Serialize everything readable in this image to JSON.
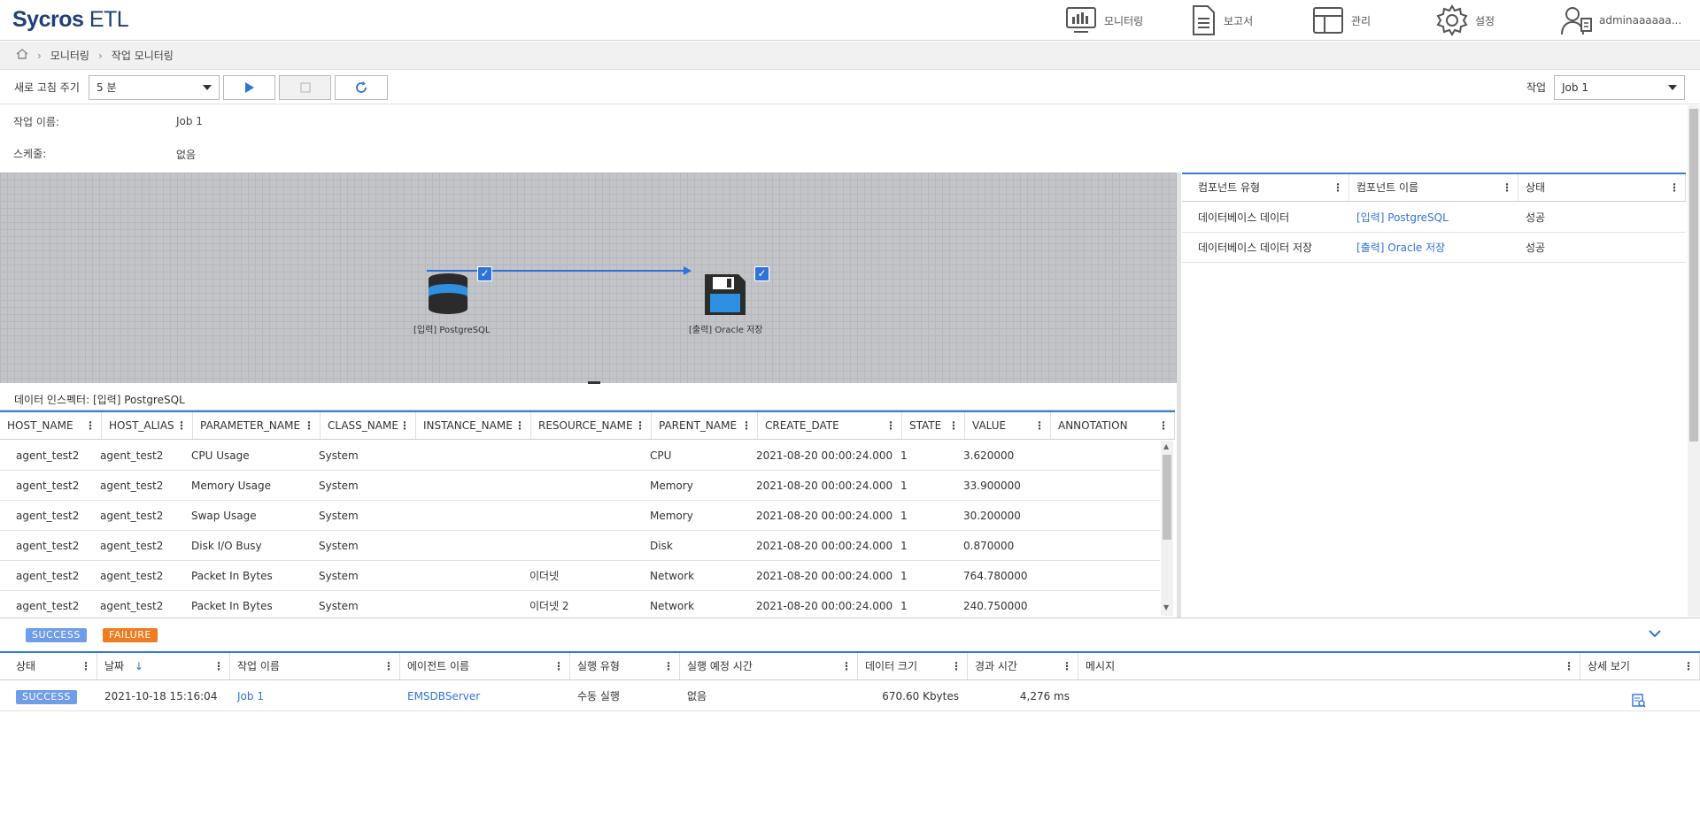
{
  "header": {
    "logo_main": "Sycros",
    "logo_sub": "ETL",
    "nav": [
      {
        "label": "모니터링",
        "icon": "monitor-icon"
      },
      {
        "label": "보고서",
        "icon": "report-icon"
      },
      {
        "label": "관리",
        "icon": "admin-icon"
      },
      {
        "label": "설정",
        "icon": "gear-icon"
      },
      {
        "label": "adminaaaaaa...",
        "icon": "user-icon"
      }
    ]
  },
  "breadcrumb": {
    "items": [
      "모니터링",
      "작업 모니터링"
    ]
  },
  "toolbar": {
    "refresh_label": "새로 고침 주기",
    "refresh_value": "5 분",
    "job_label": "작업",
    "job_value": "Job 1"
  },
  "info": {
    "job_name_label": "작업 이름:",
    "job_name_value": "Job 1",
    "schedule_label": "스케줄:",
    "schedule_value": "없음"
  },
  "canvas": {
    "nodes": [
      {
        "label": "[입력] PostgreSQL",
        "icon": "database-icon"
      },
      {
        "label": "[출력] Oracle 저장",
        "icon": "save-icon"
      }
    ]
  },
  "inspector": {
    "title": "데이터 인스펙터: [입력] PostgreSQL",
    "columns": [
      "HOST_NAME",
      "HOST_ALIAS",
      "PARAMETER_NAME",
      "CLASS_NAME",
      "INSTANCE_NAME",
      "RESOURCE_NAME",
      "PARENT_NAME",
      "CREATE_DATE",
      "STATE",
      "VALUE",
      "ANNOTATION"
    ],
    "rows": [
      [
        "agent_test2",
        "agent_test2",
        "CPU Usage",
        "System",
        "",
        "",
        "CPU",
        "2021-08-20 00:00:24.000",
        "1",
        "3.620000",
        ""
      ],
      [
        "agent_test2",
        "agent_test2",
        "Memory Usage",
        "System",
        "",
        "",
        "Memory",
        "2021-08-20 00:00:24.000",
        "1",
        "33.900000",
        ""
      ],
      [
        "agent_test2",
        "agent_test2",
        "Swap Usage",
        "System",
        "",
        "",
        "Memory",
        "2021-08-20 00:00:24.000",
        "1",
        "30.200000",
        ""
      ],
      [
        "agent_test2",
        "agent_test2",
        "Disk I/O Busy",
        "System",
        "",
        "",
        "Disk",
        "2021-08-20 00:00:24.000",
        "1",
        "0.870000",
        ""
      ],
      [
        "agent_test2",
        "agent_test2",
        "Packet In Bytes",
        "System",
        "",
        "이더넷",
        "Network",
        "2021-08-20 00:00:24.000",
        "1",
        "764.780000",
        ""
      ],
      [
        "agent_test2",
        "agent_test2",
        "Packet In Bytes",
        "System",
        "",
        "이더넷 2",
        "Network",
        "2021-08-20 00:00:24.000",
        "1",
        "240.750000",
        ""
      ]
    ]
  },
  "components": {
    "columns": [
      "컴포넌트 유형",
      "컴포넌트 이름",
      "상태"
    ],
    "rows": [
      [
        "데이터베이스 데이터",
        "[입력] PostgreSQL",
        "성공"
      ],
      [
        "데이터베이스 데이터 저장",
        "[출력] Oracle 저장",
        "성공"
      ]
    ]
  },
  "history": {
    "filters": [
      "SUCCESS",
      "FAILURE"
    ],
    "columns": [
      "상태",
      "날짜",
      "작업 이름",
      "에이전트 이름",
      "실행 유형",
      "실행 예정 시간",
      "데이터 크기",
      "경과 시간",
      "메시지",
      "상세 보기"
    ],
    "sort_indicator": "↓",
    "rows": [
      [
        "SUCCESS",
        "2021-10-18 15:16:04",
        "Job 1",
        "EMSDBServer",
        "수동 실행",
        "없음",
        "670.60 Kbytes",
        "4,276 ms",
        ""
      ]
    ]
  },
  "colors": {
    "accent": "#3a7bd5",
    "brand": "#1f3f7a",
    "success": "#6f9de8",
    "failure": "#f07c20",
    "canvas_bg": "#c2c4c8"
  }
}
